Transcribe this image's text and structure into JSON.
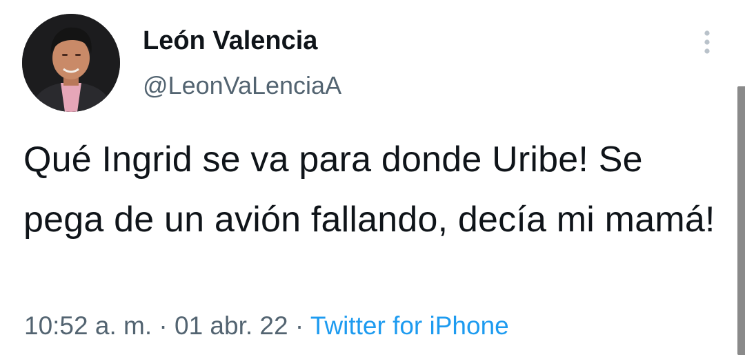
{
  "author": {
    "display_name": "León Valencia",
    "handle": "@LeonVaLenciaA",
    "avatar_icon": "profile-photo"
  },
  "tweet": {
    "text": "Qué Ingrid se va para donde Uribe! Se pega de un avión fallando, decía mi mamá!"
  },
  "meta": {
    "time": "10:52 a. m.",
    "separator": "·",
    "date": "01 abr. 22",
    "source": "Twitter for iPhone"
  },
  "menu": {
    "icon": "more-vertical-icon"
  },
  "colors": {
    "text": "#0f1419",
    "secondary": "#536471",
    "link": "#1d9bf0",
    "scrollbar": "#8a8a8a"
  }
}
